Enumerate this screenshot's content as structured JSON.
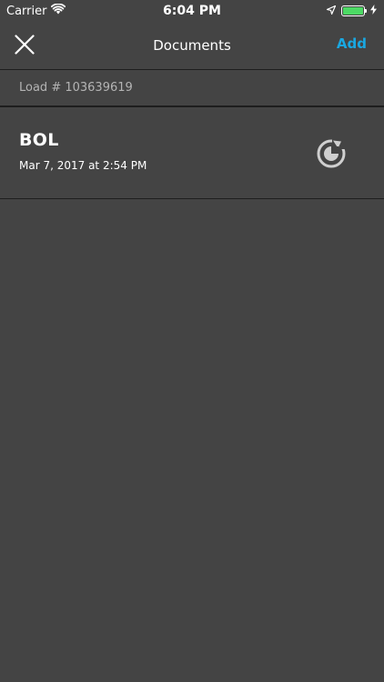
{
  "status_bar": {
    "carrier": "Carrier",
    "time": "6:04 PM",
    "battery_color": "#4cd964"
  },
  "nav": {
    "title": "Documents",
    "add_label": "Add",
    "close_icon": "close-icon",
    "accent_color": "#1aa7e0"
  },
  "load": {
    "label": "Load # 103639619"
  },
  "documents": [
    {
      "title": "BOL",
      "date": "Mar 7, 2017 at 2:54 PM",
      "status_icon": "sync-pending-icon"
    }
  ]
}
